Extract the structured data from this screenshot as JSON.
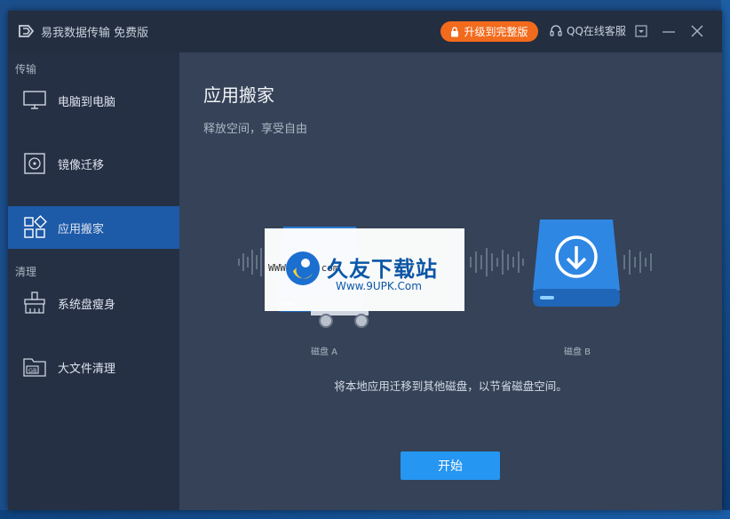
{
  "app": {
    "title": "易我数据传输 免费版",
    "upgrade_label": "升级到完整版",
    "support_label": "QQ在线客服"
  },
  "sidebar": {
    "sections": [
      {
        "label": "传输"
      },
      {
        "label": "清理"
      }
    ],
    "items": [
      {
        "label": "电脑到电脑",
        "icon": "monitor-icon"
      },
      {
        "label": "镜像迁移",
        "icon": "disc-image-icon"
      },
      {
        "label": "应用搬家",
        "icon": "apps-grid-icon",
        "active": true
      },
      {
        "label": "系统盘瘦身",
        "icon": "broom-icon"
      },
      {
        "label": "大文件清理",
        "icon": "large-file-folder-icon"
      }
    ]
  },
  "main": {
    "title": "应用搬家",
    "subtitle": "释放空间，享受自由",
    "disk_a_label": "磁盘 A",
    "disk_b_label": "磁盘 B",
    "description": "将本地应用迁移到其他磁盘，以节省磁盘空间。",
    "start_label": "开始"
  },
  "watermark": {
    "url_top": "WWW.9UPK.com",
    "brand": "久友下载站",
    "url_bottom": "Www.9UPK.Com"
  },
  "colors": {
    "accent": "#1d5aa8",
    "start_button": "#2596f1",
    "upgrade_button": "#f26b1d",
    "background": "#354257"
  }
}
